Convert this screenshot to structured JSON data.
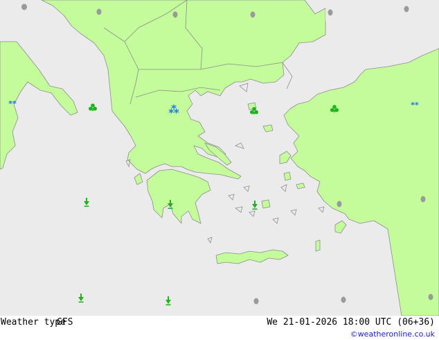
{
  "footer": {
    "title": "Weather type",
    "model": "GFS",
    "datetime": "We 21-01-2026 18:00 UTC (06+36)",
    "copyright": "©weatheronline.co.uk"
  },
  "legend_colors": {
    "land": "#c4fc9c",
    "sea": "#ebebeb",
    "border": "#9a9a9a",
    "rain_symbol": "#1db31d",
    "snow_symbol": "#1a78e0",
    "dry_symbol": "#9a9a9a"
  },
  "symbols": {
    "snow": "snow-symbol",
    "showers": "shower-symbol",
    "drizzle": "drizzle-symbol",
    "dry": "dry-symbol"
  }
}
